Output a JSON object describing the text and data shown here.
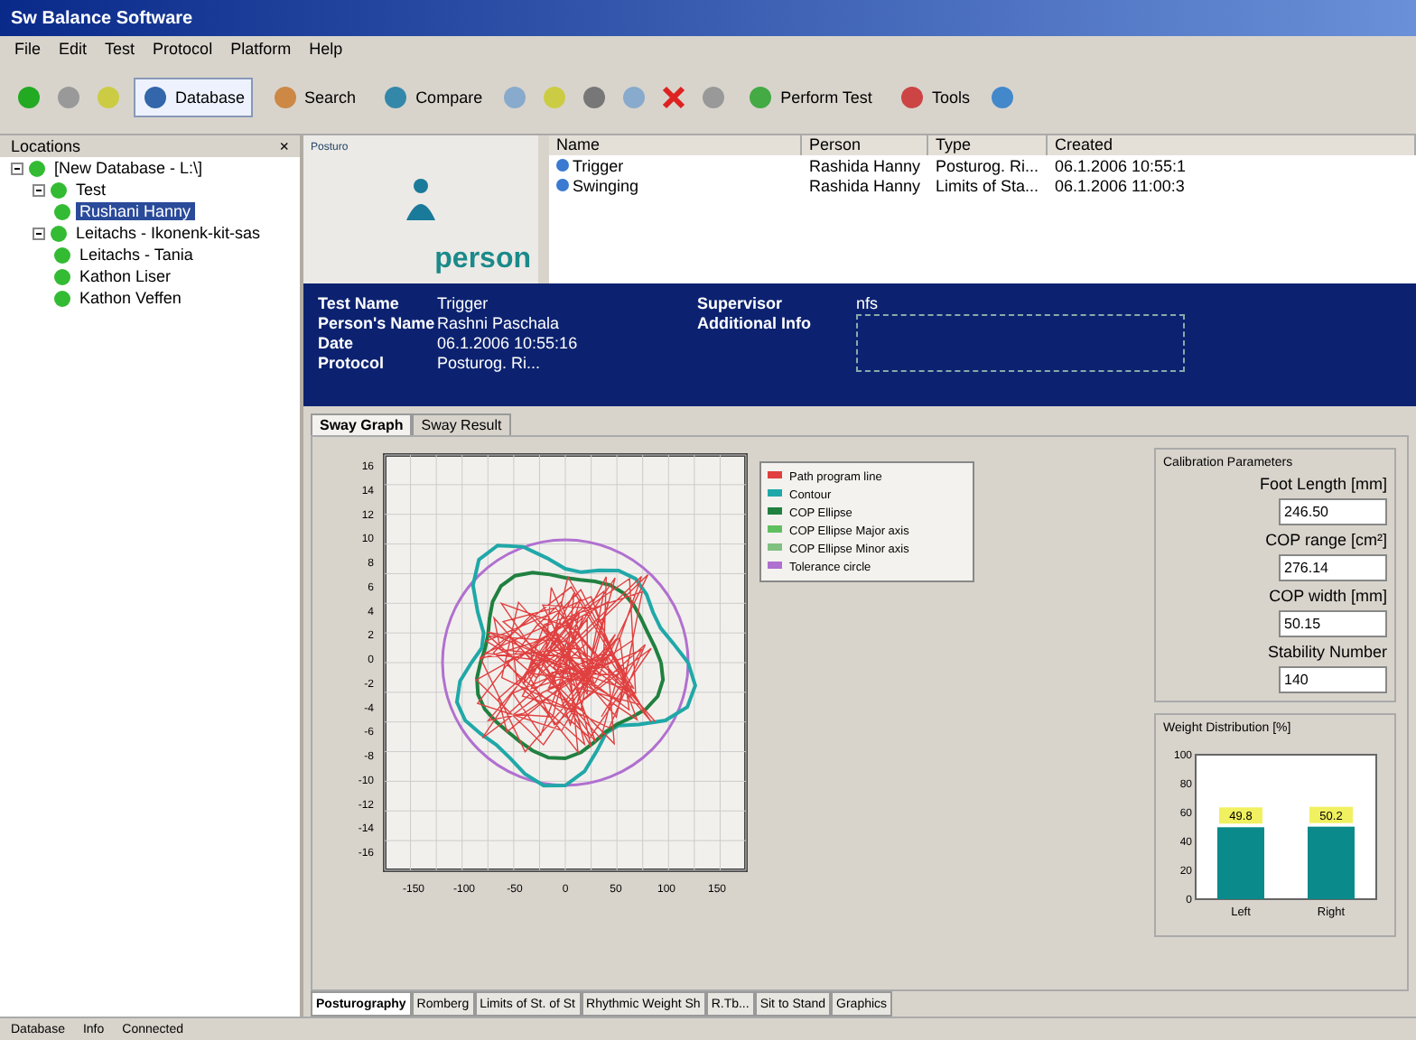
{
  "window": {
    "title": "Sw Balance Software"
  },
  "menu": [
    "File",
    "Edit",
    "Test",
    "Protocol",
    "Platform",
    "Help"
  ],
  "toolbar": [
    {
      "kind": "icon"
    },
    {
      "kind": "icon"
    },
    {
      "kind": "icon"
    },
    {
      "kind": "labeled",
      "label": "Database",
      "selected": true
    },
    {
      "kind": "labeled",
      "label": "Search",
      "selected": false
    },
    {
      "kind": "labeled",
      "label": "Compare",
      "selected": false
    },
    {
      "kind": "icon"
    },
    {
      "kind": "icon"
    },
    {
      "kind": "icon"
    },
    {
      "kind": "icon"
    },
    {
      "kind": "icon"
    },
    {
      "kind": "icon"
    },
    {
      "kind": "labeled",
      "label": "Perform Test",
      "selected": false
    },
    {
      "kind": "labeled",
      "label": "Tools",
      "selected": false
    },
    {
      "kind": "icon"
    }
  ],
  "sidebar": {
    "title": "Locations",
    "close": "×",
    "tree": [
      {
        "label": "[New Database - L:\\]",
        "expanded": true,
        "children": [
          {
            "label": "Test",
            "expanded": true,
            "children": [
              {
                "label": "Rushani Hanny",
                "selected": true
              }
            ]
          },
          {
            "label": "Leitachs - Ikonenk-kit-sas",
            "expanded": true,
            "children": [
              {
                "label": "Leitachs - Tania",
                "selected": false
              },
              {
                "label": "Kathon Liser",
                "selected": false
              },
              {
                "label": "Kathon Veffen",
                "selected": false
              }
            ]
          }
        ]
      }
    ]
  },
  "banner": {
    "small_caption": "Posturo",
    "caption": "person"
  },
  "table": {
    "columns": [
      "Name",
      "Person",
      "Type",
      "Created"
    ],
    "rows": [
      {
        "cells": [
          "Trigger",
          "Rashida Hanny",
          "Posturog. Ri...",
          "06.1.2006 10:55:1"
        ]
      },
      {
        "cells": [
          "Swinging",
          "Rashida Hanny",
          "Limits of Sta...",
          "06.1.2006 11:00:3"
        ]
      }
    ]
  },
  "info": {
    "fields": [
      {
        "label": "Test Name",
        "value": "Trigger"
      },
      {
        "label": "Person's Name",
        "value": "Rashni Paschala"
      },
      {
        "label": "Date",
        "value": "06.1.2006 10:55:16"
      },
      {
        "label": "Protocol",
        "value": "Posturog. Ri..."
      }
    ],
    "supervisor": {
      "label": "Supervisor",
      "value": "nfs"
    },
    "additional": {
      "label": "Additional Info"
    }
  },
  "tabs": [
    {
      "label": "Sway Graph",
      "selected": true
    },
    {
      "label": "Sway Result",
      "selected": false
    }
  ],
  "sway": {
    "yticks": [
      "16",
      "14",
      "12",
      "10",
      "8",
      "6",
      "4",
      "2",
      "0",
      "-2",
      "-4",
      "-6",
      "-8",
      "-10",
      "-12",
      "-14",
      "-16"
    ],
    "xticks": [
      "-150",
      "-100",
      "-50",
      "0",
      "50",
      "100",
      "150"
    ],
    "legend": [
      {
        "label": "Path program line",
        "color": "#e04040"
      },
      {
        "label": "Contour",
        "color": "#20a8a8"
      },
      {
        "label": "COP Ellipse",
        "color": "#208040"
      },
      {
        "label": "COP Ellipse Major axis",
        "color": "#60c060"
      },
      {
        "label": "COP Ellipse Minor axis",
        "color": "#80c080"
      },
      {
        "label": "Tolerance circle",
        "color": "#b070d0"
      }
    ]
  },
  "calibration": {
    "title": "Calibration Parameters",
    "fields": [
      {
        "label": "Foot Length [mm]",
        "value": "246.50"
      },
      {
        "label": "COP range [cm²]",
        "value": "276.14"
      },
      {
        "label": "COP width [mm]",
        "value": "50.15"
      },
      {
        "label": "Stability Number",
        "value": "140"
      }
    ]
  },
  "weight": {
    "title": "Weight Distribution [%]",
    "chart_data": {
      "type": "bar",
      "categories": [
        "Left",
        "Right"
      ],
      "values": [
        49.8,
        50.2
      ],
      "ylim": [
        0,
        100
      ],
      "yticks": [
        0,
        20,
        40,
        60,
        80,
        100
      ],
      "value_labels": [
        "49.8",
        "50.2"
      ]
    }
  },
  "bottom_tabs": [
    {
      "label": "Posturography",
      "selected": true
    },
    {
      "label": "Romberg",
      "selected": false
    },
    {
      "label": "Limits of St. of St",
      "selected": false
    },
    {
      "label": "Rhythmic Weight Sh",
      "selected": false
    },
    {
      "label": "R.Tb...",
      "selected": false
    },
    {
      "label": "Sit to Stand",
      "selected": false
    },
    {
      "label": "Graphics",
      "selected": false
    }
  ],
  "status_bar": [
    "Database",
    "Info",
    "Connected"
  ]
}
